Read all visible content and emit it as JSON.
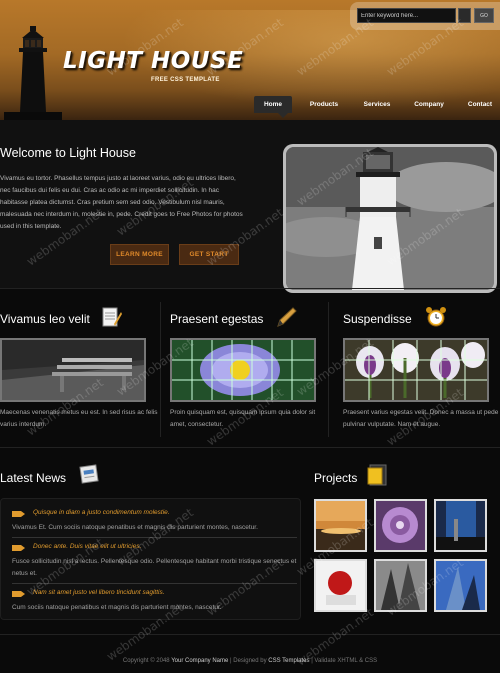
{
  "header": {
    "title": "LIGHT HOUSE",
    "tagline": "FREE CSS TEMPLATE",
    "logo_icon": "lighthouse-icon"
  },
  "search": {
    "value": "Enter keyword here...",
    "button_label": "GO"
  },
  "nav": {
    "items": [
      {
        "label": "Home",
        "active": true
      },
      {
        "label": "Products"
      },
      {
        "label": "Services"
      },
      {
        "label": "Company"
      },
      {
        "label": "Contact"
      }
    ]
  },
  "welcome": {
    "title": "Welcome to Light House",
    "text": "Vivamus eu tortor. Phasellus tempus justo at laoreet varius, odio eu ultrices libero, nec faucibus dui felis eu dui. Cras ac odio ac mi imperdiet sollicitudin. In hac habitasse platea dictumst. Cras pretium sem sed odio. Vestibulum nisl mauris, malesuada nec interdum in, molestie in, pede. Credit goes to Free Photos for photos used in this template.",
    "learn_more": "LEARN MORE",
    "get_start": "GET START"
  },
  "features": [
    {
      "title": "Vivamus leo velit",
      "icon": "notepad-pencil-icon",
      "text": "Maecenas venenatis metus eu est. In sed risus ac felis varius interdum."
    },
    {
      "title": "Praesent egestas",
      "icon": "pen-icon",
      "text": "Proin quisquam est, quisquam ipsum quia dolor sit amet, consectetur."
    },
    {
      "title": "Suspendisse",
      "icon": "alarm-clock-icon",
      "text": "Praesent varius egestas velit. Donec a massa ut pede pulvinar vulputate. Nam et augue."
    }
  ],
  "news": {
    "title": "Latest News",
    "icon": "newspaper-icon",
    "items": [
      {
        "headline": "Quisque in diam a justo condimentum molestie.",
        "body": "Vivamus Et. Cum sociis natoque penatibus et magnis dis parturient montes, nascetur."
      },
      {
        "headline": "Donec ante. Duis vitae elit ut ultricies.",
        "body": "Fusce sollicitudin nisl a lectus. Pellentesque odio. Pellentesque habitant morbi tristique senectus et netus et."
      },
      {
        "headline": "Nam sit amet justo vel libero tincidunt sagittis.",
        "body": "Cum sociis natoque penatibus et magnis dis parturient montes, nascetur."
      }
    ]
  },
  "projects": {
    "title": "Projects",
    "icon": "folder-icon"
  },
  "footer": {
    "copyright": "Copyright © 2048",
    "company": "Your Company Name",
    "designed_by": "| Designed by",
    "templates": "CSS Templates",
    "validate": "| Validate XHTML & CSS"
  },
  "watermark": "webmoban.net",
  "colors": {
    "accent": "#e09b2e",
    "header_top": "#b8782a",
    "background": "#0a0a0a"
  }
}
